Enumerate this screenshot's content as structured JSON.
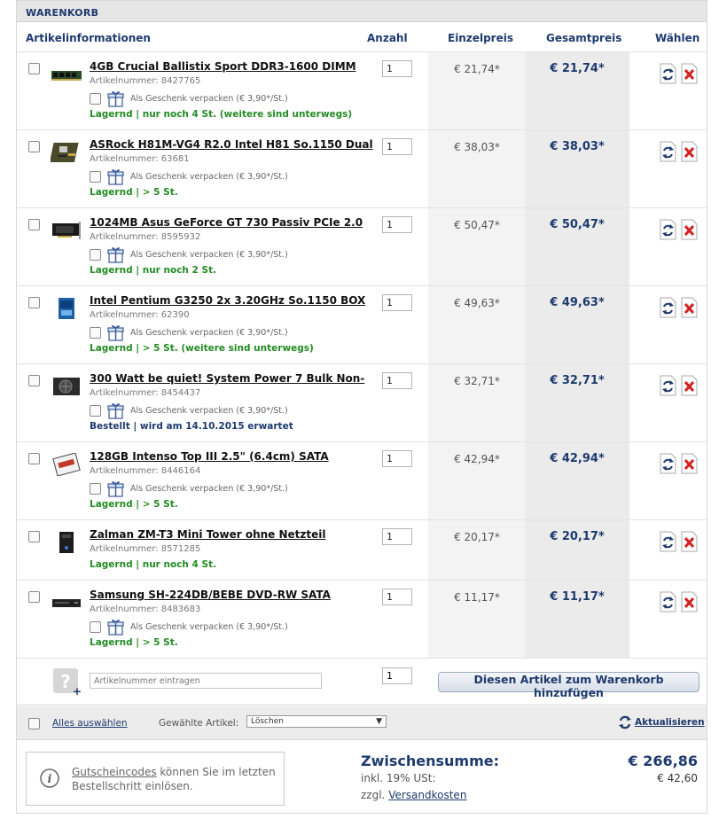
{
  "cart": {
    "title": "WARENKORB",
    "columns": {
      "info": "Artikelinformationen",
      "qty": "Anzahl",
      "unit": "Einzelpreis",
      "total": "Gesamtpreis",
      "choose": "Wählen"
    },
    "items": [
      {
        "name": "4GB Crucial Ballistix Sport DDR3-1600 DIMM",
        "artnr": "Artikelnummer: 8427765",
        "gift": "Als Geschenk verpacken (€ 3,90*/St.)",
        "avail": "Lagernd | nur noch 4 St. (weitere sind unterwegs)",
        "avail_color": "green",
        "qty": "1",
        "unit": "€ 21,74*",
        "total": "€ 21,74*",
        "icon": "ram-module-icon"
      },
      {
        "name": "ASRock H81M-VG4 R2.0 Intel H81 So.1150 Dual",
        "artnr": "Artikelnummer: 63681",
        "gift": "Als Geschenk verpacken (€ 3,90*/St.)",
        "avail": "Lagernd | > 5 St.",
        "avail_color": "green",
        "qty": "1",
        "unit": "€ 38,03*",
        "total": "€ 38,03*",
        "icon": "motherboard-icon"
      },
      {
        "name": "1024MB Asus GeForce GT 730 Passiv PCIe 2.0",
        "artnr": "Artikelnummer: 8595932",
        "gift": "Als Geschenk verpacken (€ 3,90*/St.)",
        "avail": "Lagernd | nur noch 2 St.",
        "avail_color": "green",
        "qty": "1",
        "unit": "€ 50,47*",
        "total": "€ 50,47*",
        "icon": "graphics-card-icon"
      },
      {
        "name": "Intel Pentium G3250 2x 3.20GHz So.1150 BOX",
        "artnr": "Artikelnummer: 62390",
        "gift": "Als Geschenk verpacken (€ 3,90*/St.)",
        "avail": "Lagernd | > 5 St. (weitere sind unterwegs)",
        "avail_color": "green",
        "qty": "1",
        "unit": "€ 49,63*",
        "total": "€ 49,63*",
        "icon": "cpu-box-icon"
      },
      {
        "name": "300 Watt be quiet! System Power 7 Bulk Non-",
        "artnr": "Artikelnummer: 8454437",
        "gift": "Als Geschenk verpacken (€ 3,90*/St.)",
        "avail": "Bestellt | wird am 14.10.2015 erwartet",
        "avail_color": "blue",
        "qty": "1",
        "unit": "€ 32,71*",
        "total": "€ 32,71*",
        "icon": "power-supply-icon"
      },
      {
        "name": "128GB Intenso Top III 2.5\" (6.4cm) SATA",
        "artnr": "Artikelnummer: 8446164",
        "gift": "Als Geschenk verpacken (€ 3,90*/St.)",
        "avail": "Lagernd | > 5 St.",
        "avail_color": "green",
        "qty": "1",
        "unit": "€ 42,94*",
        "total": "€ 42,94*",
        "icon": "ssd-icon"
      },
      {
        "name": "Zalman ZM-T3 Mini Tower ohne Netzteil",
        "artnr": "Artikelnummer: 8571285",
        "gift": "",
        "avail": "Lagernd | nur noch 4 St.",
        "avail_color": "green",
        "qty": "1",
        "unit": "€ 20,17*",
        "total": "€ 20,17*",
        "icon": "pc-case-icon"
      },
      {
        "name": "Samsung SH-224DB/BEBE DVD-RW SATA",
        "artnr": "Artikelnummer: 8483683",
        "gift": "Als Geschenk verpacken (€ 3,90*/St.)",
        "avail": "Lagernd | > 5 St.",
        "avail_color": "green",
        "qty": "1",
        "unit": "€ 11,17*",
        "total": "€ 11,17*",
        "icon": "dvd-drive-icon"
      }
    ],
    "add": {
      "placeholder": "Artikelnummer eintragen",
      "qty": "1",
      "button": "Diesen Artikel zum Warenkorb hinzufügen"
    },
    "bulk": {
      "select_all": "Alles auswählen",
      "selected_label": "Gewählte Artikel:",
      "action": "Löschen",
      "refresh": "Aktualisieren"
    },
    "voucher": {
      "link": "Gutscheincodes",
      "text": " können Sie im letzten Bestellschritt einlösen."
    },
    "summary": {
      "subtotal_label": "Zwischensumme:",
      "subtotal": "€ 266,86",
      "tax_label": "inkl. 19% USt:",
      "tax": "€ 42,60",
      "shipping_prefix": "zzgl. ",
      "shipping_link": "Versandkosten"
    },
    "colors": {
      "accent": "#1e3a6e",
      "in_stock": "#238c23",
      "delete": "#d42020"
    }
  }
}
